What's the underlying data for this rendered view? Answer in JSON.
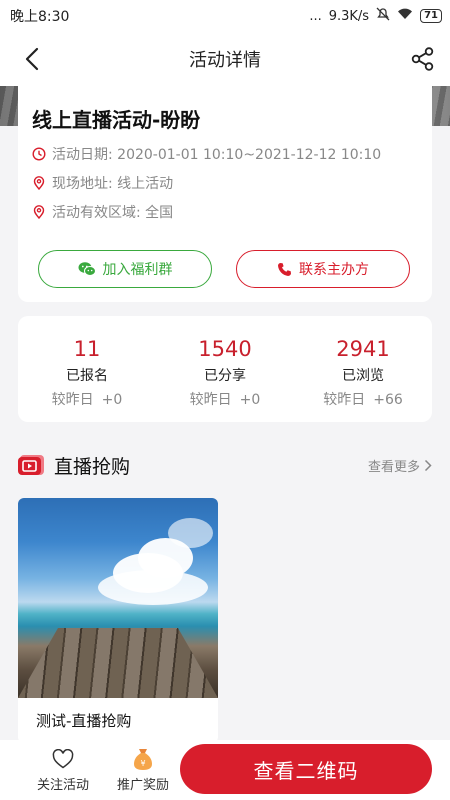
{
  "status_bar": {
    "time": "晚上8:30",
    "dots": "...",
    "network_speed": "9.3K/s",
    "battery": "71"
  },
  "nav": {
    "title": "活动详情"
  },
  "event": {
    "title": "线上直播活动-盼盼",
    "date": "活动日期: 2020-01-01 10:10~2021-12-12 10:10",
    "address": "现场地址: 线上活动",
    "region": "活动有效区域: 全国",
    "join_group_label": "加入福利群",
    "contact_label": "联系主办方"
  },
  "stats": [
    {
      "value": "11",
      "label": "已报名",
      "delta_label": "较昨日",
      "delta": "+0"
    },
    {
      "value": "1540",
      "label": "已分享",
      "delta_label": "较昨日",
      "delta": "+0"
    },
    {
      "value": "2941",
      "label": "已浏览",
      "delta_label": "较昨日",
      "delta": "+66"
    }
  ],
  "live_section": {
    "title": "直播抢购",
    "more": "查看更多",
    "products": [
      {
        "name": "测试-直播抢购"
      }
    ]
  },
  "bottom": {
    "follow_label": "关注活动",
    "reward_label": "推广奖励",
    "reward_badge": "¥",
    "qr_label": "查看二维码"
  },
  "colors": {
    "accent_red": "#d81e2c",
    "accent_green": "#3aa93e"
  }
}
